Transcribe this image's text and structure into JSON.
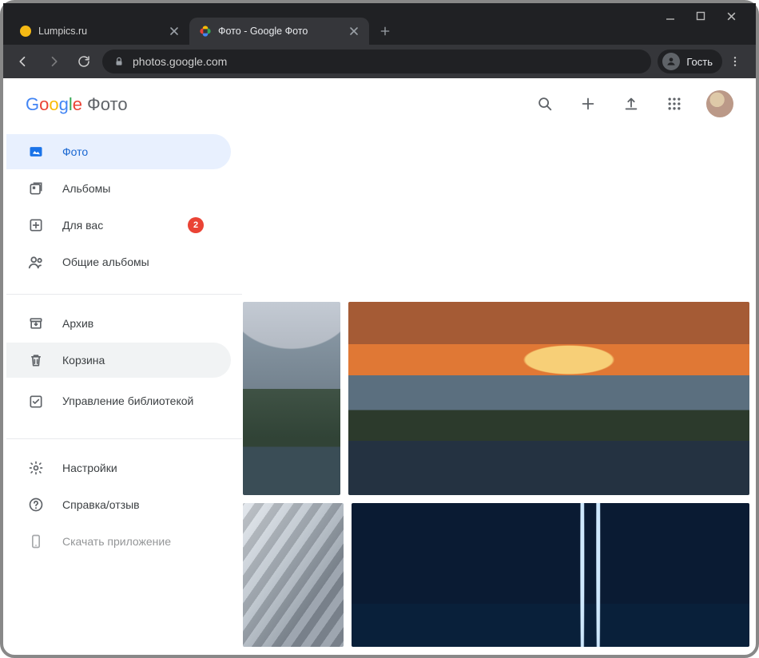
{
  "browser": {
    "tabs": [
      {
        "title": "Lumpics.ru",
        "active": false,
        "favicon_color": "#f5b914"
      },
      {
        "title": "Фото - Google Фото",
        "active": true
      }
    ],
    "address": "photos.google.com",
    "guest_label": "Гость",
    "status_url": "https://photos.google.com/trash"
  },
  "brand": {
    "name": "Google",
    "product": "Фото"
  },
  "sidebar": {
    "group1": [
      {
        "icon": "photos-icon",
        "label": "Фото",
        "active": true
      },
      {
        "icon": "albums-icon",
        "label": "Альбомы"
      },
      {
        "icon": "for-you-icon",
        "label": "Для вас",
        "badge": "2"
      },
      {
        "icon": "shared-albums-icon",
        "label": "Общие альбомы"
      }
    ],
    "group2": [
      {
        "icon": "archive-icon",
        "label": "Архив"
      },
      {
        "icon": "trash-icon",
        "label": "Корзина",
        "highlighted": true
      },
      {
        "icon": "library-manage-icon",
        "label": "Управление библиотекой"
      }
    ],
    "group3": [
      {
        "icon": "settings-icon",
        "label": "Настройки"
      },
      {
        "icon": "help-icon",
        "label": "Справка/отзыв"
      },
      {
        "icon": "download-app-icon",
        "label": "Скачать приложение"
      }
    ]
  }
}
